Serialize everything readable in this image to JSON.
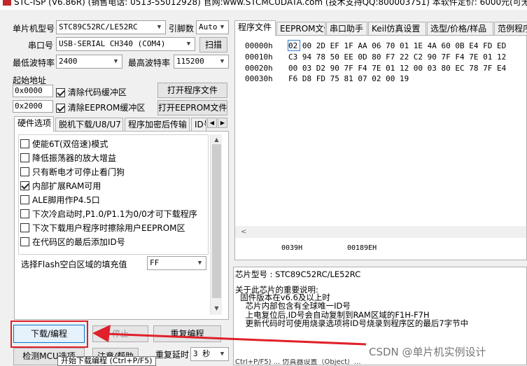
{
  "window": {
    "title": "STC-ISP (V6.86R) (销售电话: 0513-55012928) 官网:www.STCMCUDATA.com  (技术支持QQ:800003751) 本软件定价: 6000元(可无"
  },
  "left": {
    "mcu_label": "单片机型号",
    "mcu_value": "STC89C52RC/LE52RC",
    "pins_label": "引脚数",
    "pins_value": "Auto",
    "port_label": "串口号",
    "port_value": "USB-SERIAL CH340 (COM4)",
    "scan_button": "扫描",
    "min_baud_label": "最低波特率",
    "min_baud_value": "2400",
    "max_baud_label": "最高波特率",
    "max_baud_value": "115200",
    "start_addr_label": "起始地址",
    "code_addr": "0x0000",
    "clear_code_label": "清除代码缓冲区",
    "open_program_button": "打开程序文件",
    "eeprom_addr": "0x2000",
    "clear_eeprom_label": "清除EEPROM缓冲区",
    "open_eeprom_button": "打开EEPROM文件",
    "tabs": [
      "硬件选项",
      "脱机下载/U8/U7",
      "程序加密后传输",
      "ID号"
    ],
    "options": [
      {
        "label": "使能6T(双倍速)模式",
        "checked": false
      },
      {
        "label": "降低振荡器的放大增益",
        "checked": false
      },
      {
        "label": "只有断电才可停止看门狗",
        "checked": false
      },
      {
        "label": "内部扩展RAM可用",
        "checked": true
      },
      {
        "label": "ALE脚用作P4.5口",
        "checked": false
      },
      {
        "label": "下次冷启动时,P1.0/P1.1为0/0才可下载程序",
        "checked": false
      },
      {
        "label": "下次下载用户程序时擦除用户EEPROM区",
        "checked": false
      },
      {
        "label": "在代码区的最后添加ID号",
        "checked": false
      }
    ],
    "fill_label": "选择Flash空白区域的填充值",
    "fill_value": "FF",
    "download_button": "下载/编程",
    "stop_button": "停止",
    "redownload_button": "重复编程",
    "detect_button": "检测MCU选项",
    "help_button": "注意/帮助",
    "delay_label": "重复延时",
    "delay_value": "3 秒",
    "tooltip": "开始下载编程 (Ctrl+P/F5)"
  },
  "right": {
    "tabs": [
      "程序文件",
      "EEPROM文件",
      "串口助手",
      "Keil仿真设置",
      "选型/价格/样品",
      "范例程序"
    ],
    "hex_rows": [
      {
        "addr": "00000h",
        "bytes": "02 00 2D EF 1F AA 06 70 01 1E 4A 60 0B E4 FD ED"
      },
      {
        "addr": "00010h",
        "bytes": "C3 94 78 50 EE 0D 80 F7 22 C2 90 7F F4 7E 01 12"
      },
      {
        "addr": "00020h",
        "bytes": "00 03 D2 90 7F F4 7E 01 12 00 03 80 EC 78 7F E4"
      },
      {
        "addr": "00030h",
        "bytes": "F6 D8 FD 75 81 07 02 00 19"
      }
    ],
    "checksum_id": "0039H",
    "checksum_val": "00189EH",
    "info_lines": [
      "芯片型号 : STC89C52RC/LE52RC",
      "",
      "关于此芯片的重要说明:",
      "  固件版本在v6.6及以上时",
      "    芯片内部包含有全球唯一ID号",
      "    上电复位后,ID号会自动复制到RAM区域的F1H-F7H",
      "    更新代码时可使用烧录选项将ID号烧录到程序区的最后7字节中"
    ],
    "bottom_partial": "Ctrl+P/F5)   ... 仿真器设置（Object）...",
    "watermark": "CSDN @单片机实例设计"
  },
  "colors": {
    "highlight": "#e0202a",
    "arrow": "#e0202a"
  }
}
